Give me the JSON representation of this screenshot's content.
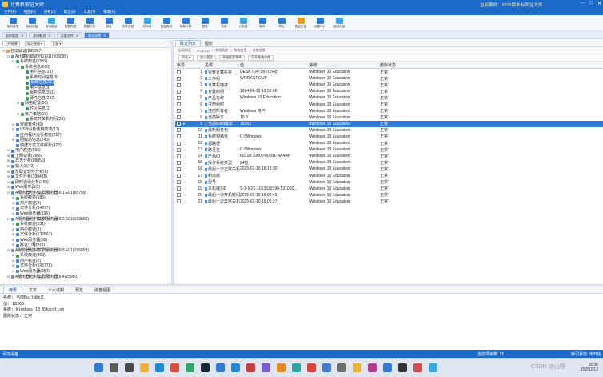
{
  "window": {
    "title": "计算机取证大师",
    "case_label": "当前案例：2025版本标取证大师",
    "controls": [
      "—",
      "□",
      "✕"
    ]
  },
  "menu": [
    "文件(F)",
    "视图(V)",
    "分析(A)",
    "取证(Z)",
    "工具(T)",
    "帮助(H)"
  ],
  "ribbon": [
    {
      "label": "案例管理",
      "icon": "case-icon"
    },
    {
      "label": "添加设备",
      "icon": "add-device-icon"
    },
    {
      "label": "自动取证",
      "icon": "auto-icon"
    },
    {
      "label": "数据恢复",
      "icon": "recover-icon"
    },
    {
      "label": "数据分析",
      "icon": "analyze-icon"
    },
    {
      "label": "搜索",
      "icon": "search-icon"
    },
    {
      "label": "文件过滤",
      "icon": "filter-icon"
    },
    {
      "label": "时间线",
      "icon": "timeline-icon"
    },
    {
      "label": "取证报告",
      "icon": "report-icon"
    },
    {
      "label": "哈希计算",
      "icon": "hash-icon"
    },
    {
      "label": "镜像",
      "icon": "image-icon"
    },
    {
      "label": "仿真",
      "icon": "emulate-icon"
    },
    {
      "label": "分析器",
      "icon": "analyzer-icon"
    },
    {
      "label": "脚本",
      "icon": "script-icon"
    },
    {
      "label": "导出",
      "icon": "export-icon"
    },
    {
      "label": "取证工具",
      "icon": "tools-icon"
    },
    {
      "label": "设置中心",
      "icon": "settings-icon"
    },
    {
      "label": "使用手册",
      "icon": "manual-icon"
    }
  ],
  "subtabs": [
    {
      "label": "案例管理",
      "active": false
    },
    {
      "label": "案例概览",
      "active": false
    },
    {
      "label": "证据文件",
      "active": false
    },
    {
      "label": "取证结果",
      "active": true
    }
  ],
  "left_toolbar": [
    "上传结果",
    "标记视图 ▾",
    "全部 ▾"
  ],
  "tree": [
    {
      "label": "自动取证(899307)",
      "level": 0,
      "expand": "⊟",
      "color": "#e8a33b",
      "selected": false
    },
    {
      "label": "A计算机取证PC(E01(503095)",
      "level": 1,
      "expand": "⊟",
      "color": "#6b8fbf",
      "selected": false
    },
    {
      "label": "系统痕迹(1559)",
      "level": 2,
      "expand": "⊟",
      "color": "#3c9d5c",
      "selected": false
    },
    {
      "label": "系统信息(610)",
      "level": 3,
      "expand": "⊟",
      "color": "#3c9d5c",
      "selected": false
    },
    {
      "label": "用户信息(19)",
      "level": 4,
      "expand": "",
      "color": "#3c9d5c",
      "selected": false
    },
    {
      "label": "系统时间信息(9)",
      "level": 4,
      "expand": "",
      "color": "#3c9d5c",
      "selected": false
    },
    {
      "label": "系统信息(21)",
      "level": 4,
      "expand": "",
      "color": "#3c9d5c",
      "selected": true
    },
    {
      "label": "用户信息(9)",
      "level": 4,
      "expand": "",
      "color": "#3c9d5c",
      "selected": false
    },
    {
      "label": "服务信息(251)",
      "level": 4,
      "expand": "",
      "color": "#3c9d5c",
      "selected": false
    },
    {
      "label": "硬件信息(242)",
      "level": 4,
      "expand": "",
      "color": "#3c9d5c",
      "selected": false
    },
    {
      "label": "网络配置(30)",
      "level": 3,
      "expand": "⊞",
      "color": "#3c9d5c",
      "selected": false
    },
    {
      "label": "时区信息(1)",
      "level": 4,
      "expand": "",
      "color": "#3c9d5c",
      "selected": false
    },
    {
      "label": "帐户策略(19)",
      "level": 3,
      "expand": "⊞",
      "color": "#3c9d5c",
      "selected": false
    },
    {
      "label": "系统开关机时间(20)",
      "level": 4,
      "expand": "",
      "color": "#3c9d5c",
      "selected": false
    },
    {
      "label": "安装软件(40)",
      "level": 2,
      "expand": "⊞",
      "color": "#4a7fcf",
      "selected": false
    },
    {
      "label": "USB设备使用痕迹(17)",
      "level": 2,
      "expand": "⊞",
      "color": "#4a7fcf",
      "selected": false
    },
    {
      "label": "应用程序运行痕迹(227)",
      "level": 2,
      "expand": "",
      "color": "#4a7fcf",
      "selected": false
    },
    {
      "label": "回收站信息(243)",
      "level": 2,
      "expand": "⊞",
      "color": "#4a7fcf",
      "selected": false
    },
    {
      "label": "快捷方式文件解析(422)",
      "level": 2,
      "expand": "",
      "color": "#4a7fcf",
      "selected": false
    },
    {
      "label": "用户痕迹(566)",
      "level": 1,
      "expand": "⊞",
      "color": "#4a7fcf",
      "selected": false
    },
    {
      "label": "上网记录(3665)",
      "level": 1,
      "expand": "⊞",
      "color": "#4a7fcf",
      "selected": false
    },
    {
      "label": "日志分析(98050)",
      "level": 1,
      "expand": "⊞",
      "color": "#4a7fcf",
      "selected": false
    },
    {
      "label": "输入法(43)",
      "level": 1,
      "expand": "⊞",
      "color": "#4a7fcf",
      "selected": false
    },
    {
      "label": "反取证软件分析(6)",
      "level": 1,
      "expand": "⊞",
      "color": "#4a7fcf",
      "selected": false
    },
    {
      "label": "文件分析(398435)",
      "level": 1,
      "expand": "⊞",
      "color": "#4a7fcf",
      "selected": false
    },
    {
      "label": "即时通讯分析(769)",
      "level": 1,
      "expand": "⊞",
      "color": "#4a7fcf",
      "selected": false
    },
    {
      "label": "Web服务器(2)",
      "level": 1,
      "expand": "⊞",
      "color": "#4a7fcf",
      "selected": false
    },
    {
      "label": "A服务器检材集群服务器001.E01(65759)",
      "level": 1,
      "expand": "⊟",
      "color": "#6b8fbf",
      "selected": false
    },
    {
      "label": "系统痕迹(685)",
      "level": 2,
      "expand": "⊞",
      "color": "#3c9d5c",
      "selected": false
    },
    {
      "label": "用户痕迹(2)",
      "level": 2,
      "expand": "⊞",
      "color": "#4a7fcf",
      "selected": false
    },
    {
      "label": "文件分析(64877)",
      "level": 2,
      "expand": "⊞",
      "color": "#4a7fcf",
      "selected": false
    },
    {
      "label": "Web服务器(195)",
      "level": 2,
      "expand": "⊞",
      "color": "#4a7fcf",
      "selected": false
    },
    {
      "label": "A服务器检材集群服务器002.E01(133560)",
      "level": 1,
      "expand": "⊟",
      "color": "#6b8fbf",
      "selected": false
    },
    {
      "label": "系统痕迹(631)",
      "level": 2,
      "expand": "⊞",
      "color": "#3c9d5c",
      "selected": false
    },
    {
      "label": "用户痕迹(2)",
      "level": 2,
      "expand": "⊞",
      "color": "#4a7fcf",
      "selected": false
    },
    {
      "label": "文件分析(132667)",
      "level": 2,
      "expand": "⊞",
      "color": "#4a7fcf",
      "selected": false
    },
    {
      "label": "Web服务器(50)",
      "level": 2,
      "expand": "⊞",
      "color": "#4a7fcf",
      "selected": false
    },
    {
      "label": "取证小程序(9)",
      "level": 2,
      "expand": "⊞",
      "color": "#4a7fcf",
      "selected": false
    },
    {
      "label": "A服务器检材集群服务器003.E01(196893)",
      "level": 1,
      "expand": "⊟",
      "color": "#6b8fbf",
      "selected": false
    },
    {
      "label": "系统痕迹(863)",
      "level": 2,
      "expand": "⊞",
      "color": "#3c9d5c",
      "selected": false
    },
    {
      "label": "用户痕迹(2)",
      "level": 2,
      "expand": "⊞",
      "color": "#4a7fcf",
      "selected": false
    },
    {
      "label": "文件分析(195778)",
      "level": 2,
      "expand": "⊞",
      "color": "#4a7fcf",
      "selected": false
    },
    {
      "label": "Web服务器(250)",
      "level": 2,
      "expand": "⊞",
      "color": "#4a7fcf",
      "selected": false
    },
    {
      "label": "A服务器检材集群服务器004(25980)",
      "level": 1,
      "expand": "⊞",
      "color": "#6b8fbf",
      "selected": false
    }
  ],
  "right_tabs": [
    {
      "label": "取证列表",
      "active": true
    },
    {
      "label": "图形",
      "active": false
    }
  ],
  "breadcrumb": [
    "自动取证",
    "PC(E01)",
    "系统痕迹",
    "系统信息",
    "系统信息"
  ],
  "right_toolbar": [
    "导出 ▾",
    "加入报告",
    "高级检索条件",
    "打开系统文件"
  ],
  "table": {
    "headers": [
      "序号",
      "名称",
      "值",
      "系统",
      "删除状态"
    ],
    "rows": [
      {
        "n": "1",
        "name": "完整计算机名",
        "value": "DESKTOP-5BTC549",
        "os": "Windows 10 Education",
        "status": "正常",
        "selected": false
      },
      {
        "n": "2",
        "name": "工作组",
        "value": "WORKGROUP",
        "os": "Windows 10 Education",
        "status": "正常",
        "selected": false
      },
      {
        "n": "3",
        "name": "计算机描述",
        "value": "",
        "os": "Windows 10 Education",
        "status": "正常",
        "selected": false
      },
      {
        "n": "4",
        "name": "安装时间",
        "value": "2024-06-12 19:02:06",
        "os": "Windows 10 Education",
        "status": "正常",
        "selected": false
      },
      {
        "n": "5",
        "name": "产品名称",
        "value": "Windows 10 Education",
        "os": "Windows 10 Education",
        "status": "正常",
        "selected": false
      },
      {
        "n": "6",
        "name": "注册组织",
        "value": "",
        "os": "Windows 10 Education",
        "status": "正常",
        "selected": false
      },
      {
        "n": "7",
        "name": "注册所有者",
        "value": "Windows 用户",
        "os": "Windows 10 Education",
        "status": "正常",
        "selected": false
      },
      {
        "n": "8",
        "name": "当前版本",
        "value": "10.0",
        "os": "Windows 10 Education",
        "status": "正常",
        "selected": false
      },
      {
        "n": "9",
        "name": "当前Build版本",
        "value": "18363",
        "os": "Windows 10 Education",
        "status": "正常",
        "selected": true
      },
      {
        "n": "10",
        "name": "最新服务包",
        "value": "",
        "os": "Windows 10 Education",
        "status": "正常",
        "selected": false
      },
      {
        "n": "11",
        "name": "系统根路径",
        "value": "C:\\Windows",
        "os": "Windows 10 Education",
        "status": "正常",
        "selected": false
      },
      {
        "n": "12",
        "name": "源路径",
        "value": "",
        "os": "Windows 10 Education",
        "status": "正常",
        "selected": false
      },
      {
        "n": "13",
        "name": "路径名",
        "value": "C:\\Windows",
        "os": "Windows 10 Education",
        "status": "正常",
        "selected": false
      },
      {
        "n": "14",
        "name": "产品ID",
        "value": "00328-10000-00001-AA494",
        "os": "Windows 10 Education",
        "status": "正常",
        "selected": false
      },
      {
        "n": "15",
        "name": "操作系统类型",
        "value": "64位",
        "os": "Windows 10 Education",
        "status": "正常",
        "selected": false
      },
      {
        "n": "16",
        "name": "最后一次正常关机时间",
        "value": "2025-02-10 16:15:30",
        "os": "Windows 10 Education",
        "status": "正常",
        "selected": false
      },
      {
        "n": "17",
        "name": "制造商",
        "value": "",
        "os": "Windows 10 Education",
        "status": "正常",
        "selected": false
      },
      {
        "n": "18",
        "name": "型号",
        "value": "",
        "os": "Windows 10 Education",
        "status": "正常",
        "selected": false
      },
      {
        "n": "19",
        "name": "本机域SID",
        "value": "S-1-5-21-1013533190-531092...",
        "os": "Windows 10 Education",
        "status": "正常",
        "selected": false
      },
      {
        "n": "20",
        "name": "最后一次开机时间，未...",
        "value": "2025-02-10 16:05:49",
        "os": "Windows 10 Education",
        "status": "正常",
        "selected": false
      },
      {
        "n": "21",
        "name": "最后一次异常关机时间",
        "value": "2025-02-10 16:05:27",
        "os": "Windows 10 Education",
        "status": "正常",
        "selected": false
      }
    ]
  },
  "bottom_tabs": [
    {
      "label": "摘要",
      "active": true
    },
    {
      "label": "文本",
      "active": false
    },
    {
      "label": "十六进制",
      "active": false
    },
    {
      "label": "预览",
      "active": false
    },
    {
      "label": "磁盘视图",
      "active": false
    }
  ],
  "detail": {
    "line1": "名称: 当前Build版本",
    "line2": "值: 18363",
    "line3": "系统: Windows 10 Education",
    "line4": "删除状态: 正常"
  },
  "status": {
    "left": "添加设备",
    "mid": "当前项目数: 21",
    "right": "索引状态: 未开始"
  },
  "taskbar": {
    "icons": [
      {
        "name": "start-icon",
        "color": "#2f7bd7"
      },
      {
        "name": "search-icon",
        "color": "#5a5a5a"
      },
      {
        "name": "task-view-icon",
        "color": "#4a4a4a"
      },
      {
        "name": "explorer-icon",
        "color": "#f2b134"
      },
      {
        "name": "edge-icon",
        "color": "#1f8ad6"
      },
      {
        "name": "chrome-icon",
        "color": "#e24b3b"
      },
      {
        "name": "app-icon",
        "color": "#33a46b"
      },
      {
        "name": "steam-icon",
        "color": "#1b2838"
      },
      {
        "name": "app-icon",
        "color": "#2f7bd7"
      },
      {
        "name": "app-icon",
        "color": "#1f8ad6"
      },
      {
        "name": "app-icon",
        "color": "#c83e3e"
      },
      {
        "name": "app-icon",
        "color": "#7b5bd6"
      },
      {
        "name": "app-icon",
        "color": "#e58a25"
      },
      {
        "name": "app-icon",
        "color": "#2aa5a0"
      },
      {
        "name": "app-icon",
        "color": "#d6453b"
      },
      {
        "name": "app-icon",
        "color": "#3b7ad6"
      },
      {
        "name": "app-icon",
        "color": "#6e6e6e"
      },
      {
        "name": "app-icon",
        "color": "#e6b43b"
      },
      {
        "name": "app-icon",
        "color": "#b33d8c"
      },
      {
        "name": "app-icon",
        "color": "#2f7bd7"
      },
      {
        "name": "app-icon",
        "color": "#333333"
      },
      {
        "name": "app-icon",
        "color": "#d64c4c"
      },
      {
        "name": "app-icon",
        "color": "#3aa7e0"
      }
    ],
    "watermark": "CSDN @山野",
    "time": "16:36",
    "date": "2025/2/12"
  }
}
